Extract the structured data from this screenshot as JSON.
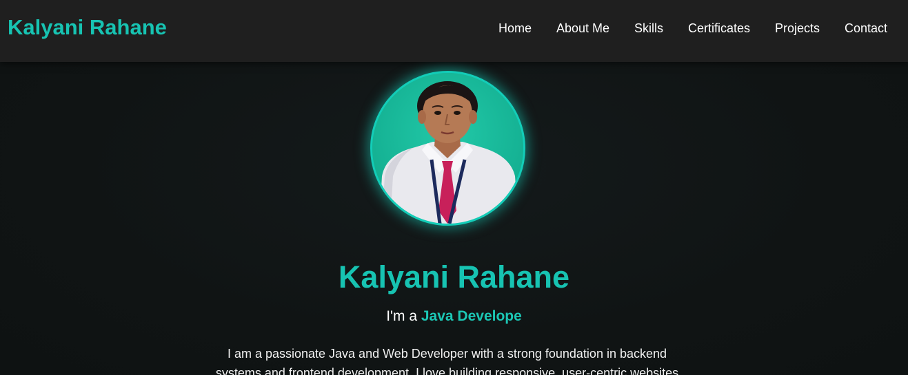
{
  "navbar": {
    "brand": "Kalyani Rahane",
    "links": [
      {
        "label": "Home"
      },
      {
        "label": "About Me"
      },
      {
        "label": "Skills"
      },
      {
        "label": "Certificates"
      },
      {
        "label": "Projects"
      },
      {
        "label": "Contact"
      }
    ]
  },
  "hero": {
    "name": "Kalyani Rahane",
    "role_prefix": "I'm a ",
    "role_typed": "Java Develope",
    "bio": "I am a passionate Java and Web Developer with a strong foundation in backend systems and frontend development. I love building responsive, user-centric websites"
  },
  "colors": {
    "accent": "#17c3b2",
    "navbar_bg": "#1f1f1f",
    "page_bg": "#111516"
  }
}
